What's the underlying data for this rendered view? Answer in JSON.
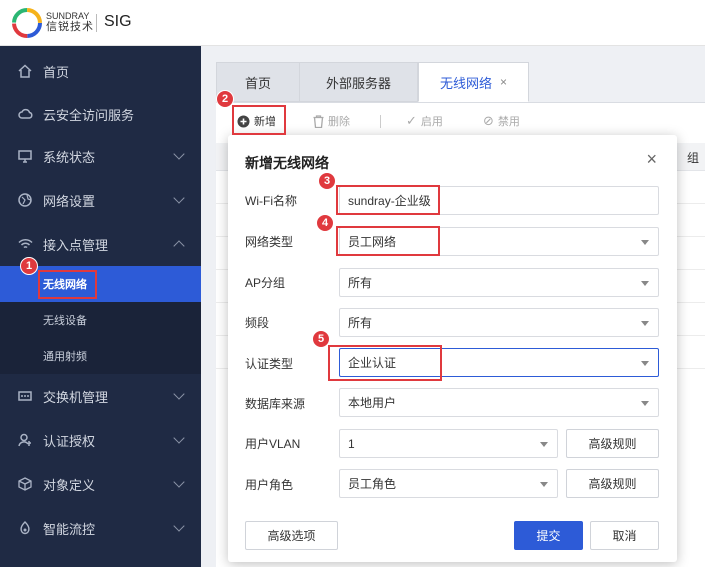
{
  "header": {
    "brand_top": "SUNDRAY",
    "brand_bottom": "信锐技术",
    "product": "SIG"
  },
  "sidebar": {
    "items": [
      {
        "label": "首页",
        "icon": "home-icon"
      },
      {
        "label": "云安全访问服务",
        "icon": "cloud-icon"
      },
      {
        "label": "系统状态",
        "icon": "monitor-icon"
      },
      {
        "label": "网络设置",
        "icon": "globe-icon"
      },
      {
        "label": "接入点管理",
        "icon": "wifi-icon"
      },
      {
        "label": "交换机管理",
        "icon": "switch-icon"
      },
      {
        "label": "认证授权",
        "icon": "user-key-icon"
      },
      {
        "label": "对象定义",
        "icon": "cube-icon"
      },
      {
        "label": "智能流控",
        "icon": "flow-icon"
      }
    ],
    "subitems": [
      "无线网络",
      "无线设备",
      "通用射频"
    ]
  },
  "tabs": [
    {
      "label": "首页"
    },
    {
      "label": "外部服务器"
    },
    {
      "label": "无线网络",
      "close": "×"
    }
  ],
  "toolbar": {
    "add": "新增",
    "delete": "删除",
    "enable": "启用",
    "disable": "禁用"
  },
  "grid": {
    "header_tail": "组"
  },
  "annotations": [
    "1",
    "2",
    "3",
    "4",
    "5"
  ],
  "modal": {
    "title": "新增无线网络",
    "close": "×",
    "fields": {
      "wifi_name": {
        "label": "Wi-Fi名称",
        "value": "sundray-企业级"
      },
      "network_type": {
        "label": "网络类型",
        "value": "员工网络"
      },
      "ap_group": {
        "label": "AP分组",
        "value": "所有"
      },
      "band": {
        "label": "频段",
        "value": "所有"
      },
      "auth_type": {
        "label": "认证类型",
        "value": "企业认证"
      },
      "db_source": {
        "label": "数据库来源",
        "value": "本地用户"
      },
      "user_vlan": {
        "label": "用户VLAN",
        "value": "1",
        "button": "高级规则"
      },
      "user_role": {
        "label": "用户角色",
        "value": "员工角色",
        "button": "高级规则"
      }
    },
    "advanced": "高级选项",
    "submit": "提交",
    "cancel": "取消"
  },
  "colors": {
    "accent": "#2d5bd7",
    "sidebar": "#1f2a44",
    "annotation": "#e0393e"
  }
}
